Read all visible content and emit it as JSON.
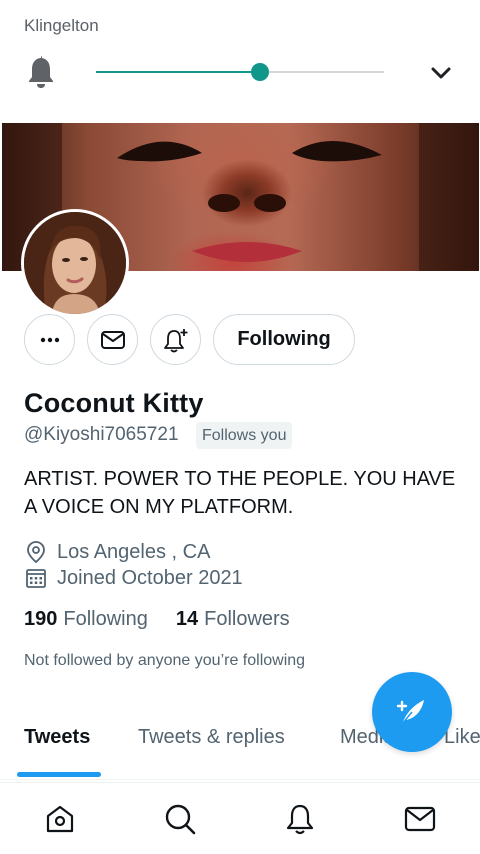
{
  "volume_panel": {
    "title": "Klingelton",
    "level_percent": 57,
    "icons": {
      "mute": "bell-icon",
      "expand": "chevron-down-icon"
    },
    "accent": "#10968a"
  },
  "profile": {
    "name": "Coconut Kitty",
    "handle": "@Kiyoshi7065721",
    "follows_you": "Follows you",
    "bio": "ARTIST. POWER TO THE PEOPLE. YOU HAVE A VOICE ON MY PLATFORM.",
    "location": "Los Angeles , CA",
    "joined": "Joined October 2021",
    "following_count": "190",
    "following_label": "Following",
    "followers_count": "14",
    "followers_label": "Followers",
    "not_followed": "Not followed by anyone you’re following"
  },
  "actions": {
    "more_icon": "more-dots-icon",
    "message_icon": "mail-icon",
    "notify_icon": "bell-plus-icon",
    "follow_label": "Following"
  },
  "tabs": [
    {
      "label": "Tweets",
      "active": true
    },
    {
      "label": "Tweets & replies",
      "active": false
    },
    {
      "label": "Media",
      "active": false
    },
    {
      "label": "Likes",
      "active": false
    }
  ],
  "fab": {
    "icon": "compose-feather-icon",
    "color": "#1d9bf0"
  },
  "bottom_nav": [
    {
      "icon": "home-icon"
    },
    {
      "icon": "search-icon"
    },
    {
      "icon": "notifications-bell-icon"
    },
    {
      "icon": "messages-mail-icon"
    }
  ]
}
